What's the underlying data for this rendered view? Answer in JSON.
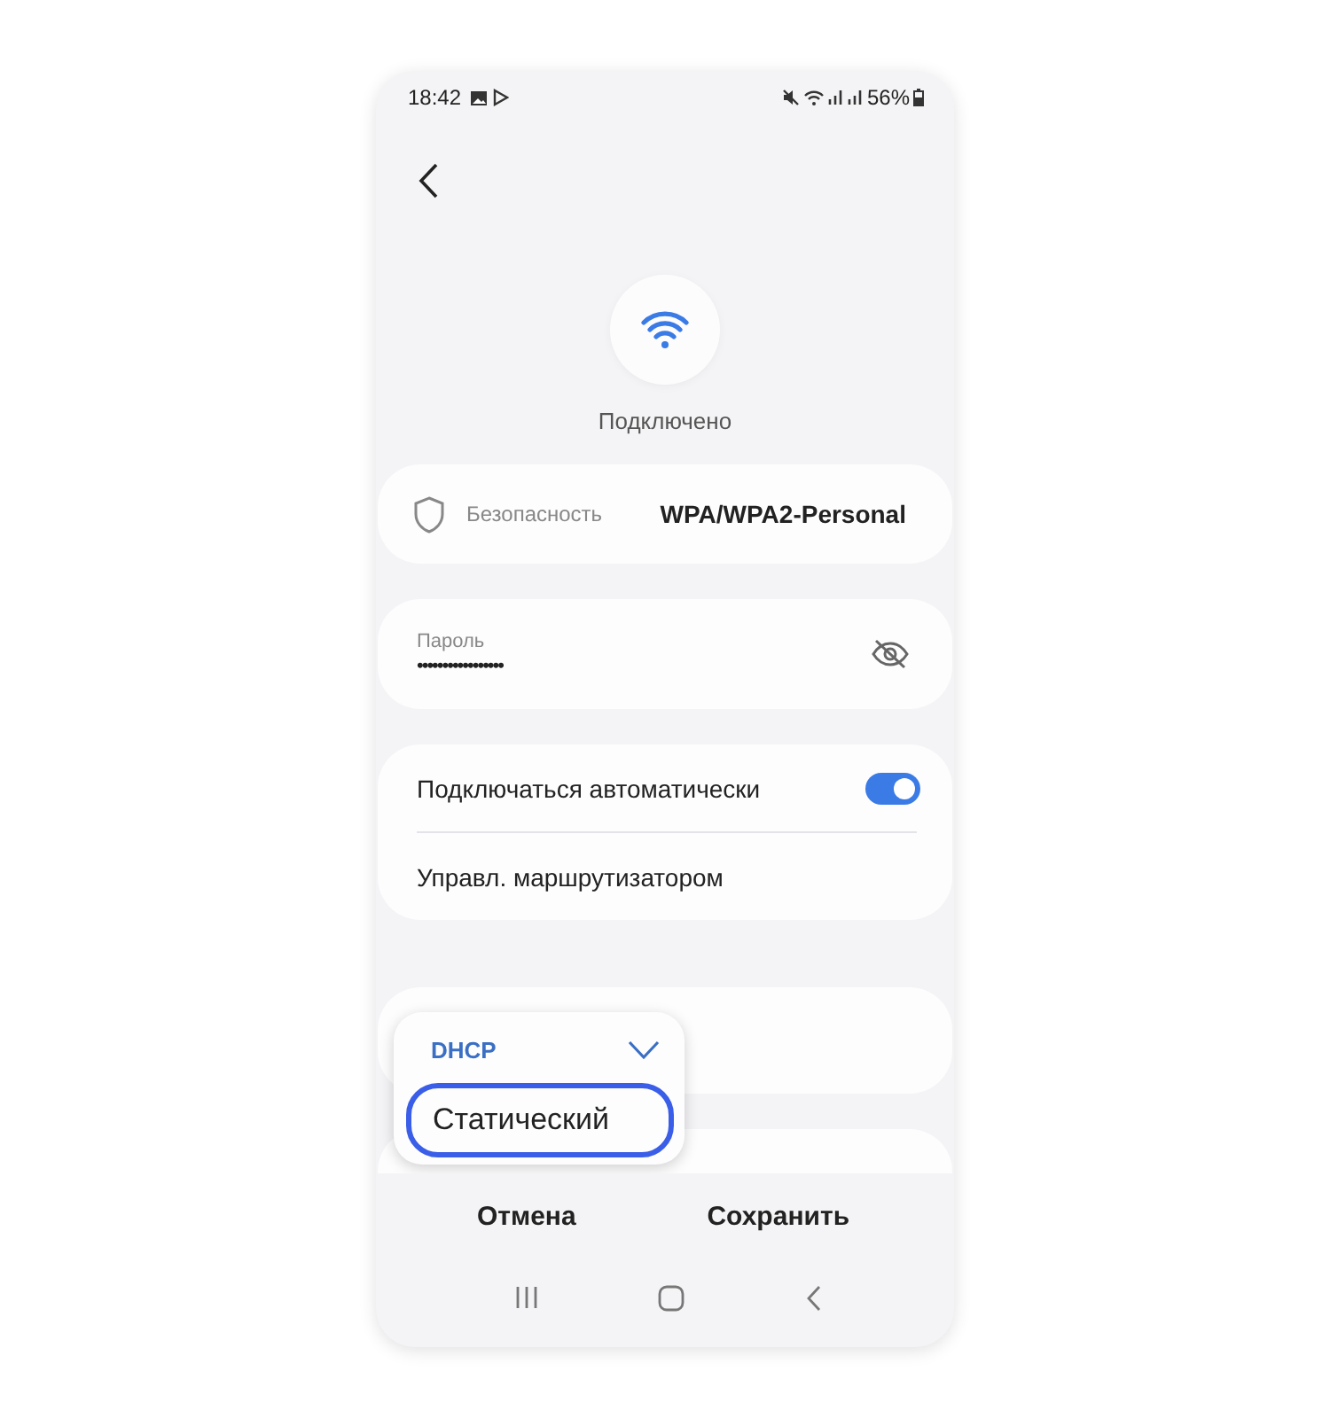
{
  "status_bar": {
    "time": "18:42",
    "battery": "56%"
  },
  "status": {
    "label": "Подключено"
  },
  "security": {
    "label": "Безопасность",
    "value": "WPA/WPA2-Personal"
  },
  "password": {
    "label": "Пароль",
    "value": "•••••••••••••••••"
  },
  "settings": [
    {
      "kind": "toggle",
      "label": "Подключаться автоматически",
      "on": true
    },
    {
      "kind": "link",
      "label": "Управл. маршрутизатором"
    }
  ],
  "ip_menu": {
    "options": [
      {
        "label": "DHCP",
        "selected": true,
        "focused": false
      },
      {
        "label": "Статический",
        "selected": false,
        "focused": true
      }
    ]
  },
  "buttons": [
    {
      "label": "Отмена"
    },
    {
      "label": "Сохранить"
    }
  ]
}
